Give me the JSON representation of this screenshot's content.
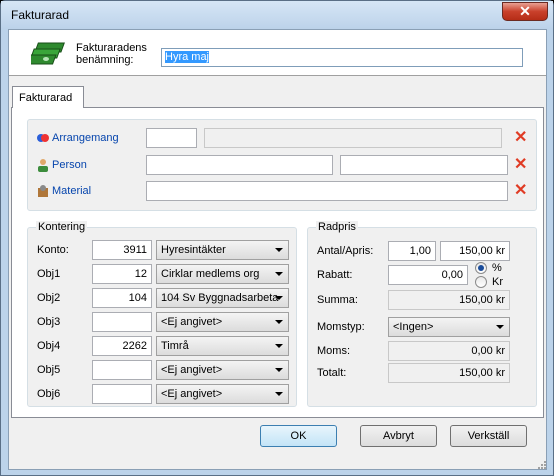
{
  "window": {
    "title": "Fakturarad",
    "close_glyph": "✕"
  },
  "header": {
    "label": "Fakturaradens benämning:",
    "name_value": "Hyra maj",
    "icon": "money-stack-icon"
  },
  "tab": {
    "label": "Fakturarad"
  },
  "links": {
    "arrangemang": "Arrangemang",
    "person": "Person",
    "material": "Material"
  },
  "remove_glyph": "✕",
  "kontering": {
    "title": "Kontering",
    "rows": [
      {
        "label": "Konto:",
        "value": "3911",
        "option": "Hyresintäkter"
      },
      {
        "label": "Obj1",
        "value": "12",
        "option": "Cirklar medlems org"
      },
      {
        "label": "Obj2",
        "value": "104",
        "option": "104 Sv Byggnadsarbeta"
      },
      {
        "label": "Obj3",
        "value": "",
        "option": "<Ej angivet>"
      },
      {
        "label": "Obj4",
        "value": "2262",
        "option": "Timrå"
      },
      {
        "label": "Obj5",
        "value": "",
        "option": "<Ej angivet>"
      },
      {
        "label": "Obj6",
        "value": "",
        "option": "<Ej angivet>"
      }
    ]
  },
  "radpris": {
    "title": "Radpris",
    "antal_label": "Antal/Apris:",
    "antal": "1,00",
    "apris": "150,00 kr",
    "rabatt_label": "Rabatt:",
    "rabatt": "0,00",
    "percent_label": "%",
    "kr_label": "Kr",
    "percent_selected": true,
    "summa_label": "Summa:",
    "summa": "150,00 kr",
    "momstyp_label": "Momstyp:",
    "momstyp": "<Ingen>",
    "moms_label": "Moms:",
    "moms": "0,00 kr",
    "totalt_label": "Totalt:",
    "totalt": "150,00 kr"
  },
  "buttons": {
    "ok": "OK",
    "cancel": "Avbryt",
    "apply": "Verkställ"
  }
}
